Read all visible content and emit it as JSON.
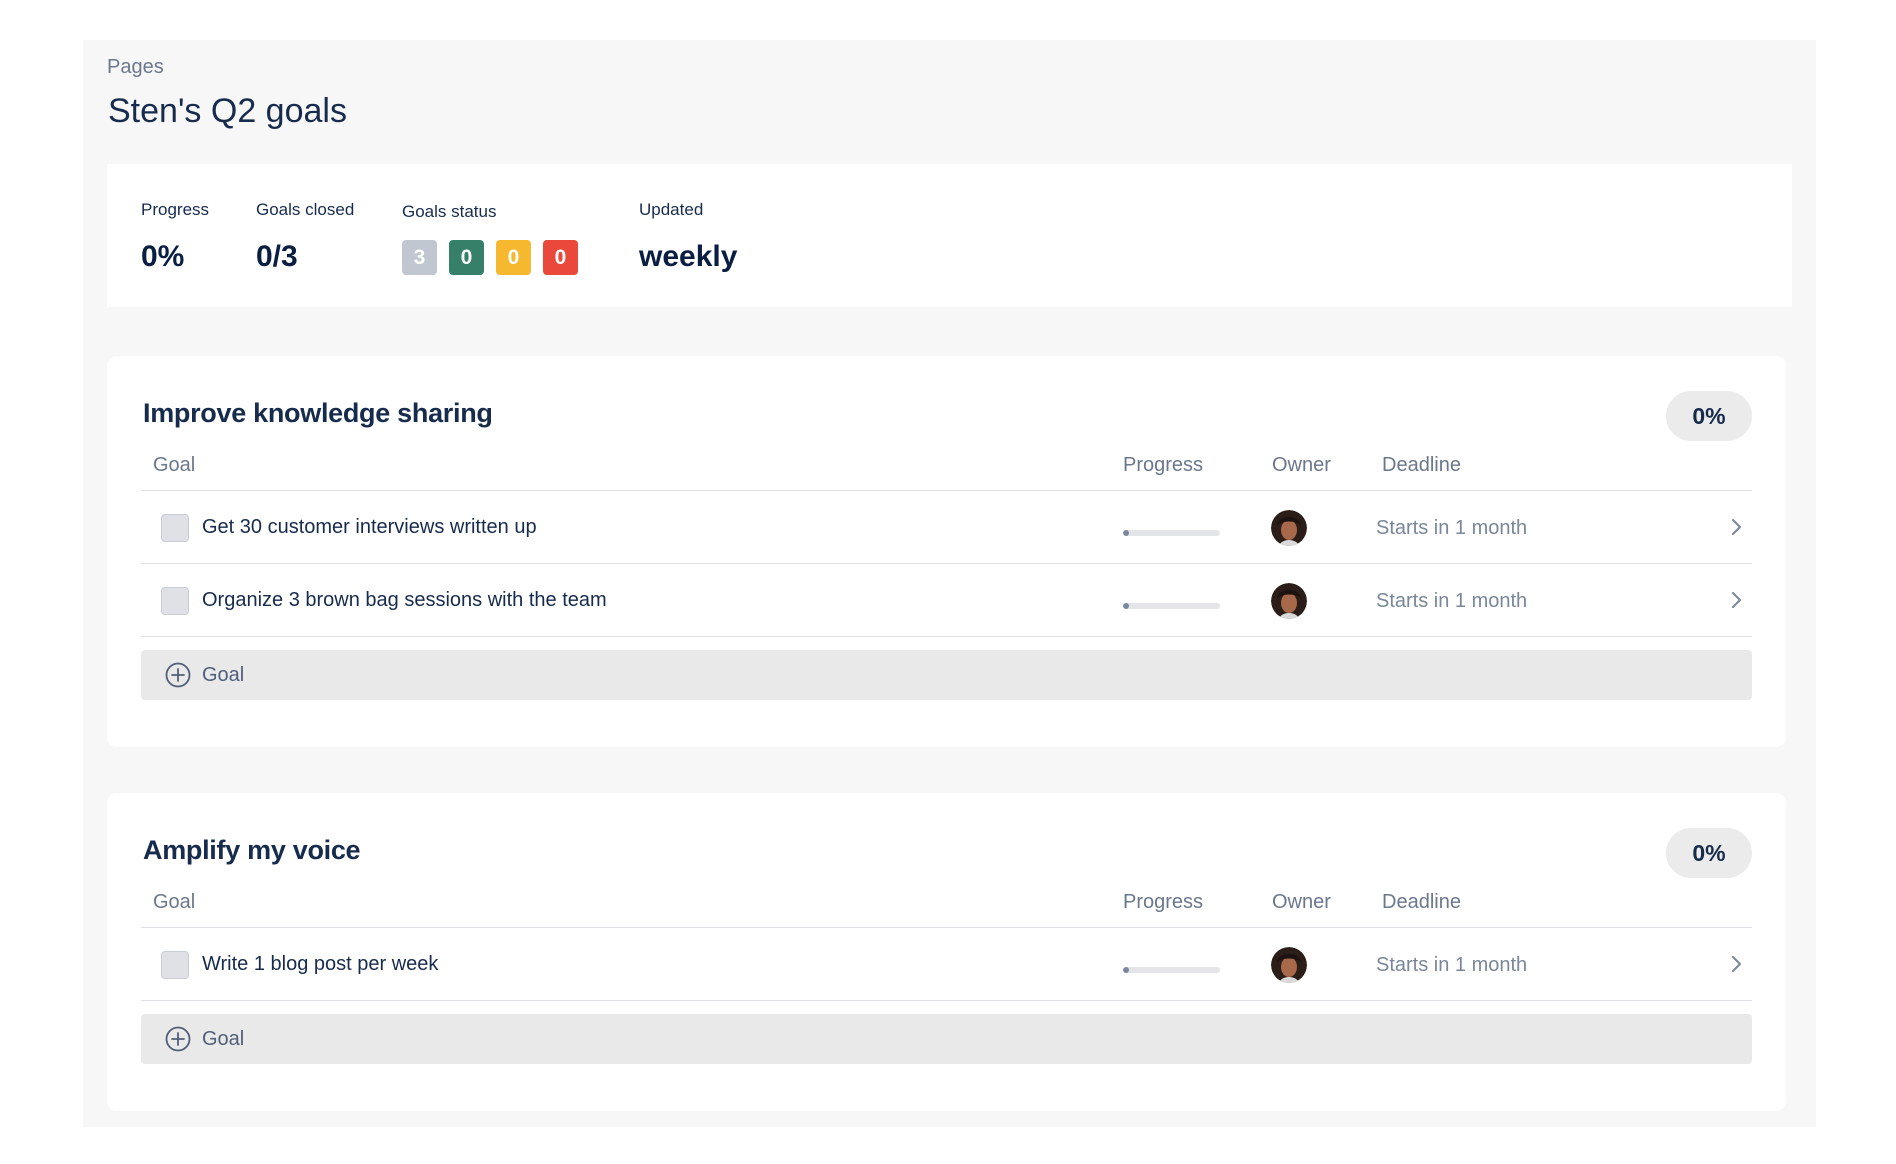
{
  "breadcrumb": "Pages",
  "page_title": "Sten's Q2 goals",
  "summary": {
    "progress_label": "Progress",
    "progress_value": "0%",
    "closed_label": "Goals closed",
    "closed_value": "0/3",
    "status_label": "Goals status",
    "status_counts": [
      {
        "value": "3",
        "color": "#c1c7d0"
      },
      {
        "value": "0",
        "color": "#36806a"
      },
      {
        "value": "0",
        "color": "#f5b82e"
      },
      {
        "value": "0",
        "color": "#e9483b"
      }
    ],
    "updated_label": "Updated",
    "updated_value": "weekly"
  },
  "columns": {
    "goal": "Goal",
    "progress": "Progress",
    "owner": "Owner",
    "deadline": "Deadline"
  },
  "sections": [
    {
      "title": "Improve knowledge sharing",
      "badge": "0%",
      "goals": [
        {
          "name": "Get 30 customer interviews written up",
          "progress": 0.0,
          "deadline": "Starts in 1 month"
        },
        {
          "name": "Organize 3 brown bag sessions with the team",
          "progress": 0.0,
          "deadline": "Starts in 1 month"
        }
      ],
      "add_label": "Goal"
    },
    {
      "title": "Amplify my voice",
      "badge": "0%",
      "goals": [
        {
          "name": "Write 1 blog post per week",
          "progress": 0.0,
          "deadline": "Starts in 1 month"
        }
      ],
      "add_label": "Goal"
    }
  ],
  "icons": {
    "row_chevron": "chevron-right-icon",
    "add": "plus-circle-icon",
    "avatar": "owner-avatar"
  }
}
